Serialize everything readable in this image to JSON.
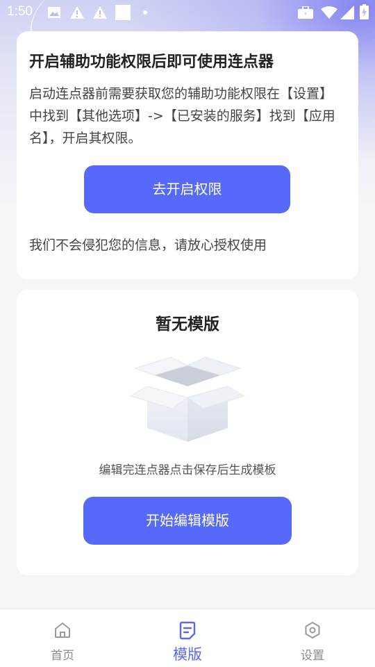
{
  "status_bar": {
    "time": "1:50",
    "icons": [
      "image-icon",
      "warning-icon",
      "warning-icon",
      "square-icon",
      "dot-icon",
      "briefcase-icon",
      "wifi-icon",
      "signal-icon",
      "battery-charging-icon"
    ]
  },
  "permission_card": {
    "title": "开启辅助功能权限后即可使用连点器",
    "description": "启动连点器前需要获取您的辅助功能权限在【设置】中找到【其他选项】->【已安装的服务】找到【应用名】，开启其权限。",
    "button_label": "去开启权限",
    "note": "我们不会侵犯您的信息，请放心授权使用"
  },
  "template_card": {
    "title": "暂无模版",
    "empty_icon": "empty-box-icon",
    "hint": "编辑完连点器点击保存后生成模板",
    "button_label": "开始编辑模版"
  },
  "bottom_nav": {
    "items": [
      {
        "label": "首页",
        "icon": "home-icon",
        "active": false
      },
      {
        "label": "模版",
        "icon": "template-icon",
        "active": true
      },
      {
        "label": "设置",
        "icon": "settings-icon",
        "active": false
      }
    ]
  },
  "colors": {
    "accent": "#5669f8",
    "background": "#f6f6f8",
    "card": "#ffffff",
    "text_primary": "#222222",
    "text_secondary": "#444444",
    "nav_inactive": "#8a8a8a"
  }
}
